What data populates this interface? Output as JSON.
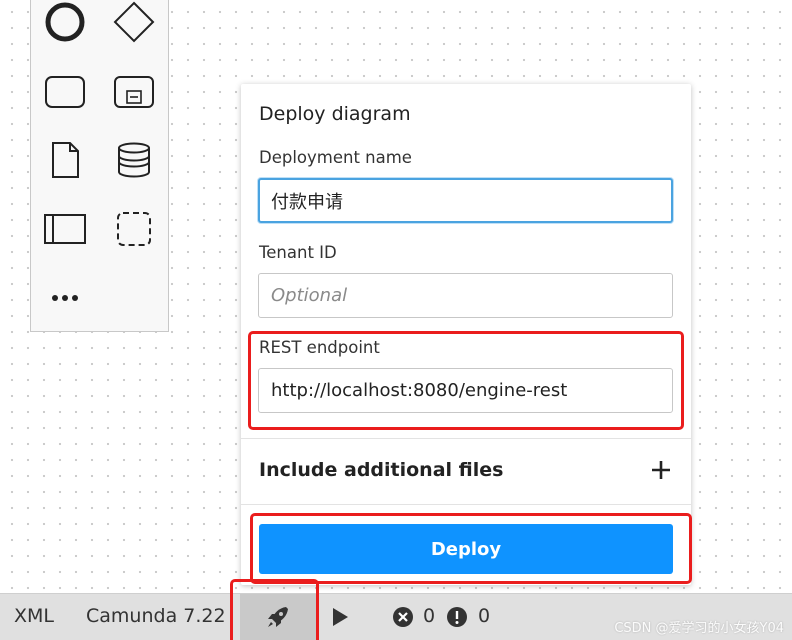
{
  "palette": {
    "tools": [
      {
        "icon": "start-event-icon"
      },
      {
        "icon": "gateway-icon"
      },
      {
        "icon": "task-icon"
      },
      {
        "icon": "subprocess-icon"
      },
      {
        "icon": "data-object-icon"
      },
      {
        "icon": "data-store-icon"
      },
      {
        "icon": "pool-icon"
      },
      {
        "icon": "group-icon"
      },
      {
        "icon": "more-icon"
      }
    ]
  },
  "deploy": {
    "title": "Deploy diagram",
    "deployment_name_label": "Deployment name",
    "deployment_name_value": "付款申请",
    "tenant_id_label": "Tenant ID",
    "tenant_id_placeholder": "Optional",
    "rest_endpoint_label": "REST endpoint",
    "rest_endpoint_value": "http://localhost:8080/engine-rest",
    "include_files_label": "Include additional files",
    "deploy_button_label": "Deploy"
  },
  "status_bar": {
    "xml_label": "XML",
    "engine_label": "Camunda 7.22",
    "error_count": "0",
    "warning_count": "0"
  },
  "watermark": "CSDN @爱学习的小女孩Y04",
  "colors": {
    "accent": "#0f93ff",
    "highlight": "#ea1d1d",
    "status_bar_bg": "#e0e0e0"
  }
}
